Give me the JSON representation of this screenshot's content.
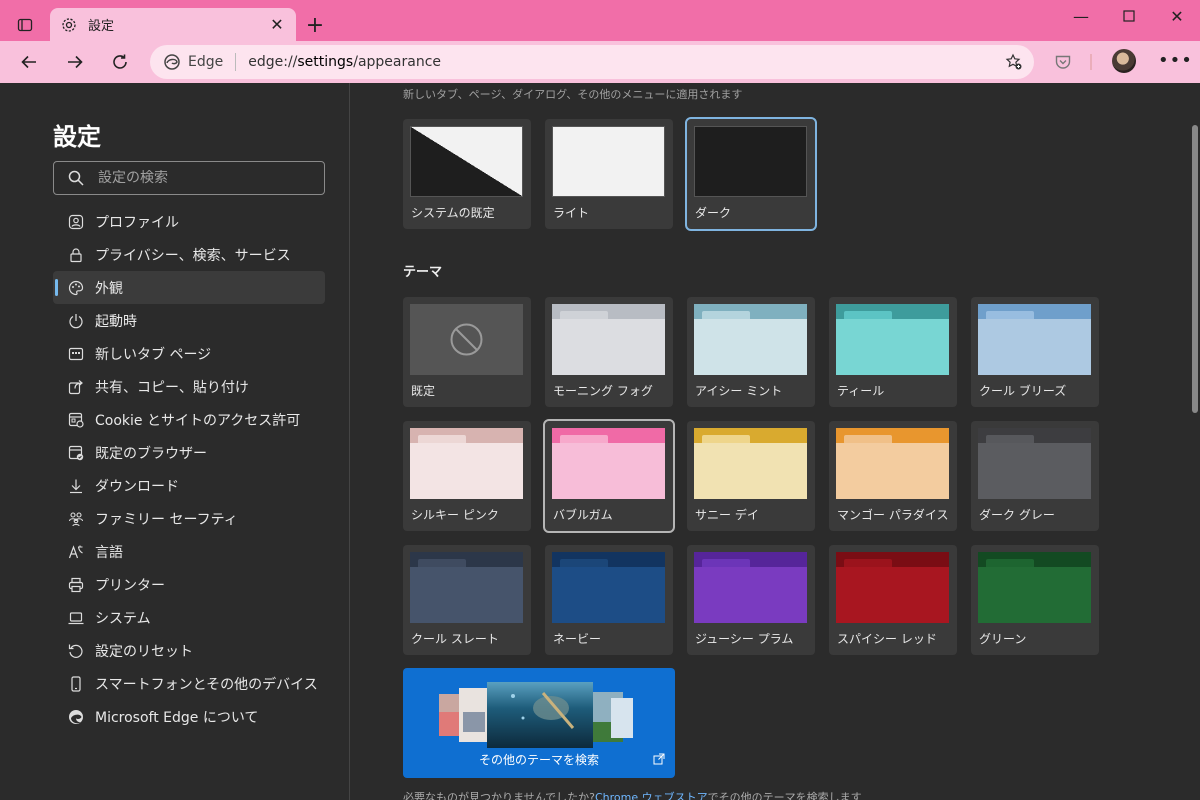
{
  "tab": {
    "title": "設定"
  },
  "address": {
    "chip_label": "Edge",
    "url_prefix": "edge://",
    "url_host": "settings",
    "url_path": "/appearance"
  },
  "sidebar": {
    "title": "設定",
    "search_placeholder": "設定の検索",
    "items": [
      {
        "label": "プロファイル",
        "icon": "profile-icon"
      },
      {
        "label": "プライバシー、検索、サービス",
        "icon": "lock-icon"
      },
      {
        "label": "外観",
        "icon": "palette-icon",
        "active": true
      },
      {
        "label": "起動時",
        "icon": "power-icon"
      },
      {
        "label": "新しいタブ ページ",
        "icon": "new-tab-page-icon"
      },
      {
        "label": "共有、コピー、貼り付け",
        "icon": "share-icon"
      },
      {
        "label": "Cookie とサイトのアクセス許可",
        "icon": "cookie-permissions-icon"
      },
      {
        "label": "既定のブラウザー",
        "icon": "default-browser-icon"
      },
      {
        "label": "ダウンロード",
        "icon": "download-icon"
      },
      {
        "label": "ファミリー セーフティ",
        "icon": "family-icon"
      },
      {
        "label": "言語",
        "icon": "language-icon"
      },
      {
        "label": "プリンター",
        "icon": "printer-icon"
      },
      {
        "label": "システム",
        "icon": "laptop-icon"
      },
      {
        "label": "設定のリセット",
        "icon": "reset-icon"
      },
      {
        "label": "スマートフォンとその他のデバイス",
        "icon": "phone-icon"
      },
      {
        "label": "Microsoft Edge について",
        "icon": "edge-logo-icon"
      }
    ]
  },
  "content": {
    "subtitle": "新しいタブ、ページ、ダイアログ、その他のメニューに適用されます",
    "appearance_options": [
      {
        "label": "システムの既定",
        "kind": "system"
      },
      {
        "label": "ライト",
        "kind": "light"
      },
      {
        "label": "ダーク",
        "kind": "dark",
        "selected": true
      }
    ],
    "theme_section_title": "テーマ",
    "themes": [
      {
        "label": "既定",
        "kind": "none"
      },
      {
        "label": "モーニング フォグ",
        "back": "#b8bcc3",
        "tab": "#cfd2d7",
        "front": "#dcdde1"
      },
      {
        "label": "アイシー ミント",
        "back": "#7fb0bf",
        "tab": "#b4d4dd",
        "front": "#cfe3e8"
      },
      {
        "label": "ティール",
        "back": "#3e9c9c",
        "tab": "#5cc4c4",
        "front": "#78d6d3"
      },
      {
        "label": "クール ブリーズ",
        "back": "#6f9fcb",
        "tab": "#98bde0",
        "front": "#adc9e2"
      },
      {
        "label": "シルキー ピンク",
        "back": "#d7b3b0",
        "tab": "#ecd7d5",
        "front": "#f3e4e4"
      },
      {
        "label": "バブルガム",
        "back": "#f06aa6",
        "tab": "#f7a9cb",
        "front": "#f7bdd8",
        "selected": true
      },
      {
        "label": "サニー デイ",
        "back": "#d9aa2f",
        "tab": "#eed58b",
        "front": "#f1e2b2"
      },
      {
        "label": "マンゴー パラダイス",
        "back": "#e8962e",
        "tab": "#f0c088",
        "front": "#f3cc9f"
      },
      {
        "label": "ダーク グレー",
        "back": "#3d3d40",
        "tab": "#57585c",
        "front": "#5b5c60"
      },
      {
        "label": "クール スレート",
        "back": "#2c3749",
        "tab": "#3f4b60",
        "front": "#46546b"
      },
      {
        "label": "ネービー",
        "back": "#123460",
        "tab": "#1b4678",
        "front": "#1d4d86"
      },
      {
        "label": "ジューシー プラム",
        "back": "#56259a",
        "tab": "#6c35b8",
        "front": "#7a3bc0"
      },
      {
        "label": "スパイシー レッド",
        "back": "#7a0d14",
        "tab": "#9b131c",
        "front": "#a81620"
      },
      {
        "label": "グリーン",
        "back": "#134a22",
        "tab": "#1d6530",
        "front": "#226c35"
      }
    ],
    "more_themes_label": "その他のテーマを検索",
    "footer_before": "必要なものが見つかりませんでしたか?",
    "footer_link": "Chrome ウェブストア",
    "footer_after": "でその他のテーマを検索します"
  }
}
